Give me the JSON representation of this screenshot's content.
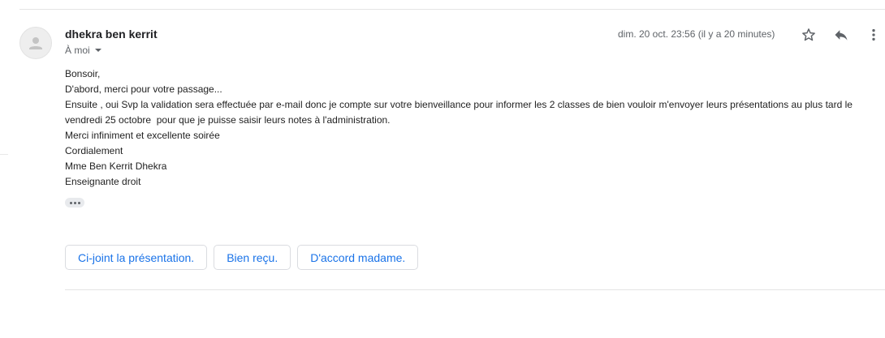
{
  "email": {
    "sender_name": "dhekra ben kerrit",
    "recipient_label": "À moi",
    "timestamp": "dim. 20 oct. 23:56 (il y a 20 minutes)",
    "body_lines": [
      "Bonsoir,",
      "D'abord, merci pour votre passage...",
      "Ensuite , oui Svp la validation sera effectuée par e-mail donc je compte sur votre bienveillance pour informer les 2 classes de bien vouloir m'envoyer leurs présentations au plus tard le vendredi 25 octobre  pour que je puisse saisir leurs notes à l'administration.",
      "Merci infiniment et excellente soirée",
      "Cordialement",
      "Mme Ben Kerrit Dhekra",
      "Enseignante droit"
    ]
  },
  "icons": {
    "avatar": "person-icon",
    "star": "star-icon",
    "reply": "reply-icon",
    "more": "more-vert-icon",
    "trimmed_content": "ellipsis-icon"
  },
  "smart_replies": [
    "Ci-joint la présentation.",
    "Bien reçu.",
    "D'accord madame."
  ],
  "colors": {
    "accent": "#1a73e8",
    "secondary_text": "#5f6368",
    "primary_text": "#202124",
    "divider": "#e4e4e4"
  }
}
